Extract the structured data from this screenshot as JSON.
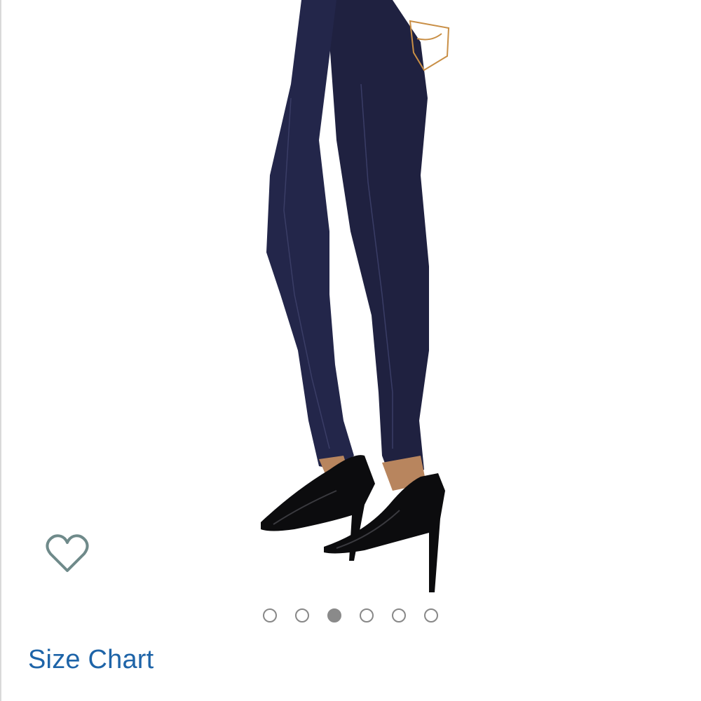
{
  "product": {
    "image_icon": "jeans-photo",
    "wishlist_icon": "heart-outline-icon"
  },
  "carousel": {
    "total": 6,
    "active_index": 2
  },
  "links": {
    "size_chart": "Size Chart"
  },
  "colors": {
    "denim": "#1f2140",
    "link": "#1e64a8",
    "dot": "#8a8a8a"
  }
}
